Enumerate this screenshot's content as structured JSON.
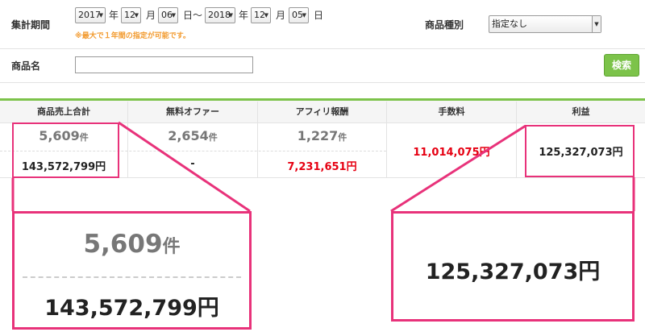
{
  "form": {
    "period_label": "集計期間",
    "start_year": "2017",
    "year_unit": "年",
    "start_month": "12",
    "month_unit": "月",
    "start_day": "06",
    "day_tilde": "日〜",
    "end_year": "2018",
    "end_month": "12",
    "end_day": "05",
    "day_unit": "日",
    "period_note": "※最大で１年間の指定が可能です。",
    "category_label": "商品種別",
    "category_value": "指定なし",
    "product_label": "商品名",
    "product_value": "",
    "search_label": "検索"
  },
  "table": {
    "headers": [
      "商品売上合計",
      "無料オファー",
      "アフィリ報酬",
      "手数料",
      "利益"
    ],
    "sales_count": "5,609",
    "count_unit": "件",
    "sales_amount": "143,572,799円",
    "free_count": "2,654",
    "free_amount": "-",
    "affiliate_count": "1,227",
    "affiliate_amount": "7,231,651円",
    "fee_amount": "11,014,075円",
    "profit_amount": "125,327,073円"
  },
  "zoom": {
    "left_count": "5,609",
    "left_unit": "件",
    "left_amount": "143,572,799円",
    "right_amount": "125,327,073円"
  },
  "colors": {
    "accent_green": "#7cc34a",
    "highlight_pink": "#e8327a",
    "amount_red": "#e60012",
    "note_orange": "#f29a2e"
  }
}
